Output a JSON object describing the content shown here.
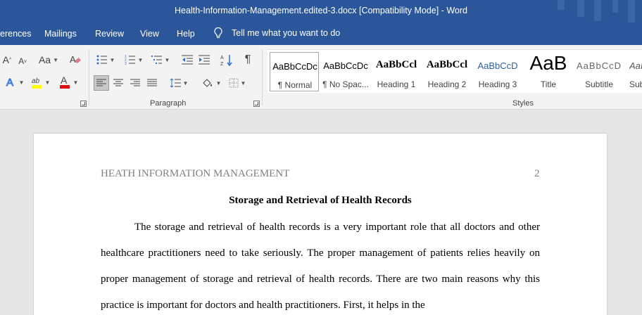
{
  "window": {
    "title": "Health-Information-Management.edited-3.docx [Compatibility Mode]  -  Word"
  },
  "tabs": {
    "references": "erences",
    "mailings": "Mailings",
    "review": "Review",
    "view": "View",
    "help": "Help",
    "tell_me": "Tell me what you want to do"
  },
  "ribbon": {
    "font_group": {
      "grow_font": "A",
      "shrink_font": "A",
      "change_case": "Aa",
      "text_effects": "A",
      "font_color_letter": "A",
      "highlight_color": "#ffff00",
      "font_color": "#e01010"
    },
    "paragraph_group": {
      "label": "Paragraph",
      "pilcrow": "¶"
    },
    "styles_group": {
      "label": "Styles",
      "items": [
        {
          "sample": "AaBbCcDc",
          "name": "¶ Normal",
          "selected": true
        },
        {
          "sample": "AaBbCcDc",
          "name": "¶ No Spac..."
        },
        {
          "sample": "AaBbCcl",
          "name": "Heading 1"
        },
        {
          "sample": "AaBbCcl",
          "name": "Heading 2"
        },
        {
          "sample": "AaBbCcD",
          "name": "Heading 3"
        },
        {
          "sample": "AaB",
          "name": "Title"
        },
        {
          "sample": "AaBbCcD",
          "name": "Subtitle"
        },
        {
          "sample": "AaI",
          "name": "Sub"
        }
      ]
    }
  },
  "document": {
    "header": "HEATH INFORMATION MANAGEMENT",
    "page_number": "2",
    "title": "Storage and Retrieval of Health Records",
    "paragraph": "The storage and retrieval of health records is a very important role that all doctors and other healthcare practitioners need to take seriously. The proper management of patients relies heavily on proper management of storage and retrieval of health records. There are two main reasons why this practice is important for doctors and health practitioners. First, it helps in the"
  }
}
